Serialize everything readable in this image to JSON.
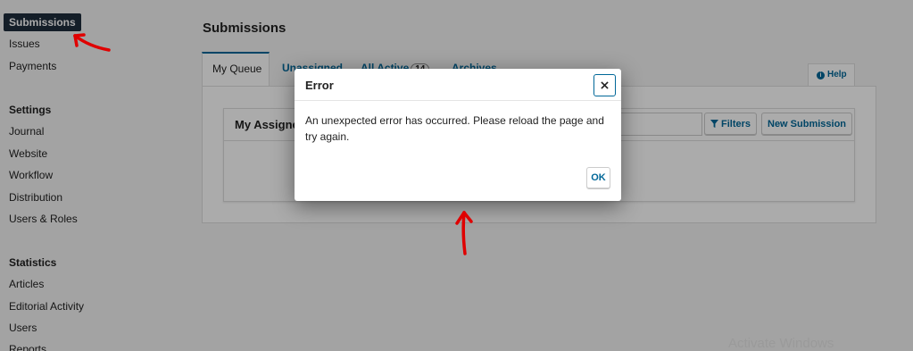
{
  "sidebar": {
    "items": [
      "Submissions",
      "Issues",
      "Payments"
    ],
    "settings_heading": "Settings",
    "settings_items": [
      "Journal",
      "Website",
      "Workflow",
      "Distribution",
      "Users & Roles"
    ],
    "statistics_heading": "Statistics",
    "statistics_items": [
      "Articles",
      "Editorial Activity",
      "Users",
      "Reports"
    ]
  },
  "main": {
    "title": "Submissions",
    "tabs": [
      {
        "label": "My Queue"
      },
      {
        "label": "Unassigned"
      },
      {
        "label": "All Active",
        "count": "14"
      },
      {
        "label": "Archives"
      }
    ],
    "help_label": "Help",
    "list_title": "My Assigned",
    "filters_label": "Filters",
    "new_submission_label": "New Submission"
  },
  "modal": {
    "title": "Error",
    "message": "An unexpected error has occurred. Please reload the page and try again.",
    "ok_label": "OK"
  },
  "watermark": "Activate Windows",
  "colors": {
    "accent": "#006798",
    "sidebar_active_bg": "#1e2d3c",
    "annotation": "#e00000"
  }
}
